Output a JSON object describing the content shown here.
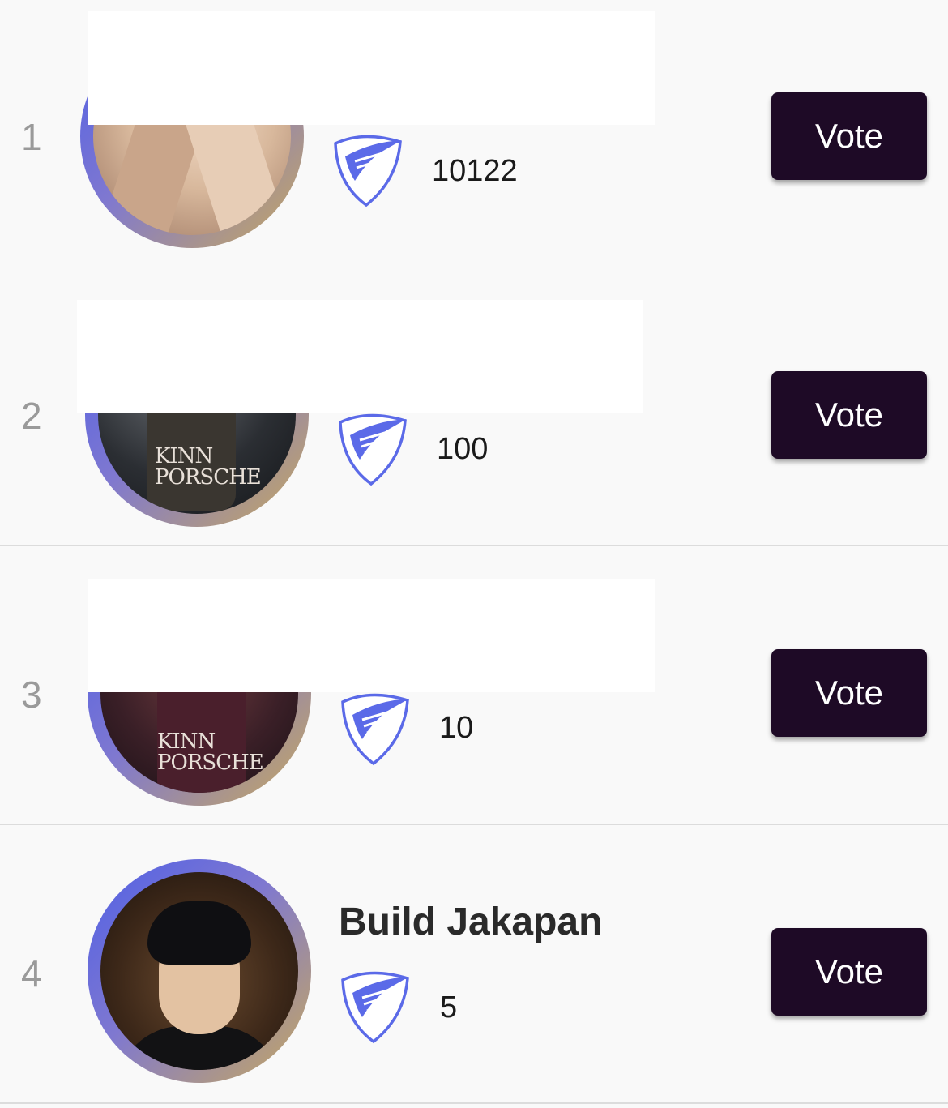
{
  "colors": {
    "vote_button_bg": "#1e0a26",
    "ring_start": "#5060e6",
    "ring_end": "#c8a95c",
    "shield_blue": "#5b6ae8"
  },
  "rows": [
    {
      "rank": "1",
      "name": "",
      "count": "10122",
      "vote_label": "Vote",
      "avatar": "avatar-beige-jacket",
      "badge_icon": "shield-wing-icon"
    },
    {
      "rank": "2",
      "name": "",
      "count": "100",
      "vote_label": "Vote",
      "avatar": "avatar-kinnporsche-poster",
      "poster_text": "KINN PORSCHE",
      "badge_icon": "shield-wing-icon"
    },
    {
      "rank": "3",
      "name": "",
      "count": "10",
      "vote_label": "Vote",
      "avatar": "avatar-kinnporsche-poster",
      "poster_text": "KINN PORSCHE",
      "badge_icon": "shield-wing-icon"
    },
    {
      "rank": "4",
      "name": "Build Jakapan",
      "count": "5",
      "vote_label": "Vote",
      "avatar": "avatar-portrait",
      "badge_icon": "shield-wing-icon"
    }
  ]
}
